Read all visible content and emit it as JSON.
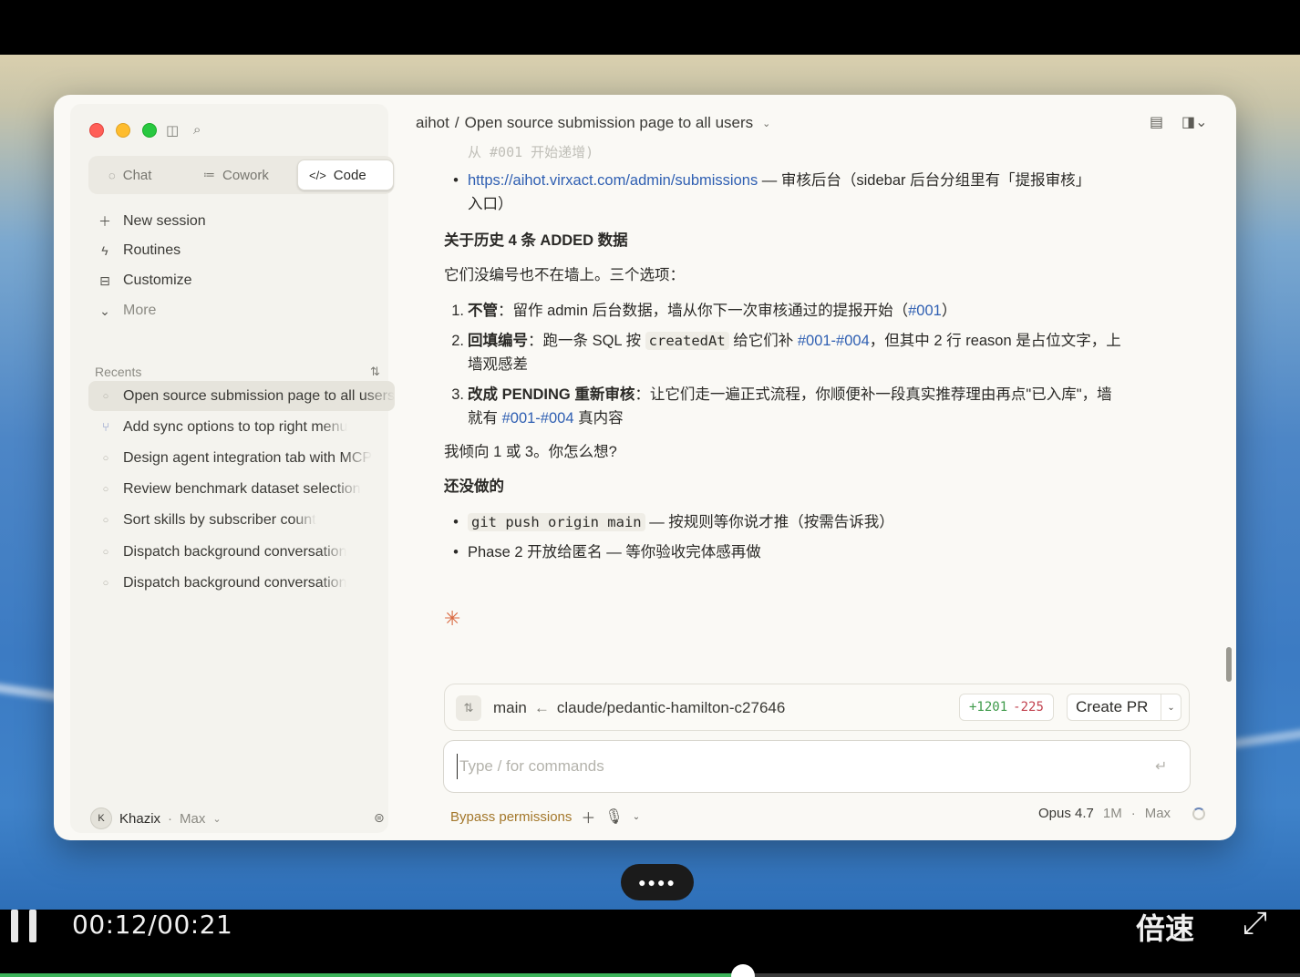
{
  "window": {
    "project": "aihot",
    "separator": "/",
    "session_title": "Open source submission page to all users"
  },
  "mode_tabs": [
    {
      "label": "Chat",
      "icon": "chat-bubble-icon"
    },
    {
      "label": "Cowork",
      "icon": "cowork-icon"
    },
    {
      "label": "Code",
      "icon": "code-icon",
      "active": true
    }
  ],
  "nav": {
    "new_session": "New session",
    "routines": "Routines",
    "customize": "Customize",
    "more": "More"
  },
  "recents": {
    "label": "Recents",
    "items": [
      {
        "title": "Open source submission page to all users",
        "active": true
      },
      {
        "title": "Add sync options to top right menu",
        "icon": "branch-icon"
      },
      {
        "title": "Design agent integration tab with MCP"
      },
      {
        "title": "Review benchmark dataset selection"
      },
      {
        "title": "Sort skills by subscriber count"
      },
      {
        "title": "Dispatch background conversation"
      },
      {
        "title": "Dispatch background conversation"
      }
    ]
  },
  "user": {
    "initial": "K",
    "name": "Khazix",
    "dot": "·",
    "plan": "Max"
  },
  "message": {
    "faded_top": "从 #001 开始递增)",
    "link_line": {
      "url": "https://aihot.virxact.com/admin/submissions",
      "text": " — 审核后台（sidebar 后台分组里有「提报审核」",
      "text2": "入口）"
    },
    "heading1": "关于历史 4 条 ADDED 数据",
    "intro": "它们没编号也不在墙上。三个选项：",
    "options": [
      {
        "num": "1.",
        "bold": "不管",
        "text": "：留作 admin 后台数据，墙从你下一次审核通过的提报开始（",
        "ref": "#001",
        "tail": "）"
      },
      {
        "num": "2.",
        "bold": "回填编号",
        "text_a": "：跑一条 SQL 按 ",
        "code": "createdAt",
        "text_b": " 给它们补 ",
        "ref": "#001-#004",
        "text_c": "，但其中 2 行 reason 是占位文字，上",
        "text_d": "墙观感差"
      },
      {
        "num": "3.",
        "bold": "改成 PENDING 重新审核",
        "text_a": "：让它们走一遍正式流程，你顺便补一段真实推荐理由再点\"已入库\"，墙",
        "text_b": "就有 ",
        "ref": "#001-#004",
        "text_c": " 真内容"
      }
    ],
    "preference": "我倾向 1 或 3。你怎么想?",
    "heading2": "还没做的",
    "todo": [
      {
        "code": "git push origin main",
        "text": " — 按规则等你说才推（按需告诉我）"
      },
      {
        "text": "Phase 2 开放给匿名 — 等你验收完体感再做"
      }
    ]
  },
  "branch": {
    "base": "main",
    "arrow": "←",
    "head": "claude/pedantic-hamilton-c27646",
    "additions": "+1201",
    "deletions": "-225",
    "create_pr": "Create PR"
  },
  "composer": {
    "placeholder": "Type / for commands",
    "value": ""
  },
  "footer": {
    "permissions": "Bypass permissions",
    "model": "Opus 4.7",
    "context": "1M",
    "dot": "·",
    "plan": "Max"
  },
  "player": {
    "time": "00:12/00:21",
    "speed_label": "倍速",
    "progress": 0.5714
  },
  "colors": {
    "accent_link": "#2f5fb2",
    "additions": "#3e9a4a",
    "deletions": "#c2424f",
    "permissions": "#a3772a",
    "spark": "#d9683f",
    "progress": "#3cb35a"
  }
}
